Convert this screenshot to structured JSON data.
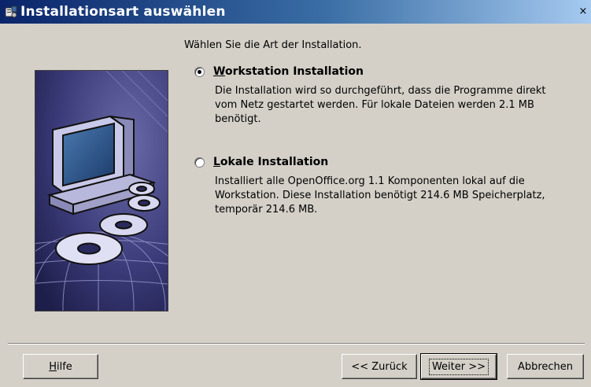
{
  "window": {
    "title": "Installationsart auswählen",
    "close_glyph": "×"
  },
  "intro_text": "Wählen Sie die Art der Installation.",
  "options": [
    {
      "label_ul": "W",
      "label_rest": "orkstation Installation",
      "selected": true,
      "description_lines": [
        "Die Installation wird so durchgeführt, dass die Programme direkt",
        "vom Netz gestartet werden. Für lokale Dateien werden 2.1 MB",
        "benötigt."
      ]
    },
    {
      "label_ul": "L",
      "label_rest": "okale Installation",
      "selected": false,
      "description_lines": [
        "Installiert alle OpenOffice.org 1.1 Komponenten lokal auf die",
        "Workstation. Diese Installation benötigt 214.6 MB Speicherplatz,",
        "temporär 214.6 MB."
      ]
    }
  ],
  "buttons": {
    "help_ul": "H",
    "help_rest": "ilfe",
    "back": "<< Zurück",
    "next": "Weiter >>",
    "cancel": "Abbrechen"
  },
  "colors": {
    "titlebar_start": "#0a246a",
    "titlebar_end": "#a6caf0",
    "dialog_bg": "#d4d0c8",
    "art_bg": "#2a2a5c"
  }
}
